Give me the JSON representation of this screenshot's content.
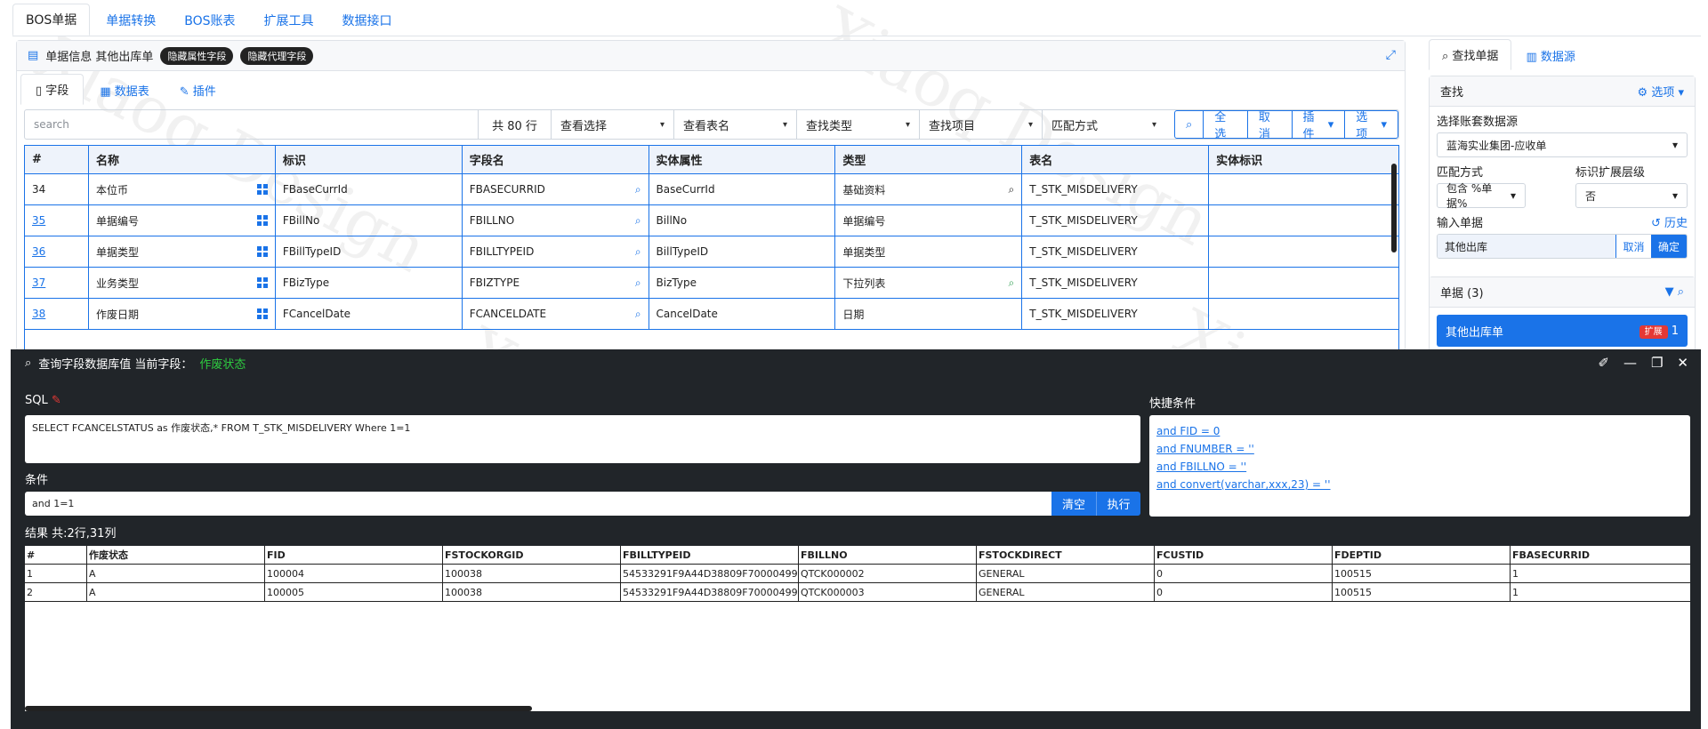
{
  "top_tabs": [
    "BOS单据",
    "单据转换",
    "BOS账表",
    "扩展工具",
    "数据接口"
  ],
  "panel": {
    "title": "单据信息 其他出库单",
    "badge1": "隐藏属性字段",
    "badge2": "隐藏代理字段",
    "subtabs": [
      "字段",
      "数据表",
      "插件"
    ]
  },
  "filter": {
    "search_placeholder": "search",
    "count": "共 80 行",
    "selects": [
      "查看选择",
      "查看表名",
      "查找类型",
      "查找项目",
      "匹配方式"
    ],
    "btn_all": "全选",
    "btn_cancel": "取消",
    "btn_plugin": "插件",
    "btn_options": "选项"
  },
  "grid": {
    "headers": [
      "#",
      "名称",
      "标识",
      "字段名",
      "实体属性",
      "类型",
      "表名",
      "实体标识"
    ],
    "rows": [
      {
        "n": "34",
        "name": "本位币",
        "key": "FBaseCurrId",
        "field": "FBASECURRID",
        "prop": "BaseCurrId",
        "type": "基础资料",
        "table": "T_STK_MISDELIVERY",
        "entity": ""
      },
      {
        "n": "35",
        "name": "单据编号",
        "key": "FBillNo",
        "field": "FBILLNO",
        "prop": "BillNo",
        "type": "单据编号",
        "table": "T_STK_MISDELIVERY",
        "entity": ""
      },
      {
        "n": "36",
        "name": "单据类型",
        "key": "FBillTypeID",
        "field": "FBILLTYPEID",
        "prop": "BillTypeID",
        "type": "单据类型",
        "table": "T_STK_MISDELIVERY",
        "entity": ""
      },
      {
        "n": "37",
        "name": "业务类型",
        "key": "FBizType",
        "field": "FBIZTYPE",
        "prop": "BizType",
        "type": "下拉列表",
        "table": "T_STK_MISDELIVERY",
        "entity": ""
      },
      {
        "n": "38",
        "name": "作废日期",
        "key": "FCancelDate",
        "field": "FCANCELDATE",
        "prop": "CancelDate",
        "type": "日期",
        "table": "T_STK_MISDELIVERY",
        "entity": ""
      }
    ]
  },
  "right": {
    "tab1": "查找单据",
    "tab2": "数据源",
    "find_title": "查找",
    "options": "选项",
    "label_source": "选择账套数据源",
    "source_value": "蓝海实业集团-应收单",
    "label_match": "匹配方式",
    "label_level": "标识扩展层级",
    "match_value": "包含 %单据%",
    "level_value": "否",
    "label_input": "输入单据",
    "history": "历史",
    "input_value": "其他出库",
    "btn_cancel": "取消",
    "btn_ok": "确定",
    "bills_title": "单据 (3)",
    "bill_active": "其他出库单",
    "bill_badge": "扩展",
    "bill_count": "1"
  },
  "modal": {
    "title": "查询字段数据库值 当前字段：",
    "current_field": "作废状态",
    "sql_label": "SQL",
    "sql": "SELECT FCANCELSTATUS as 作废状态,* FROM T_STK_MISDELIVERY Where 1=1",
    "quick_label": "快捷条件",
    "quick": [
      "and FID = 0",
      "and FNUMBER = ''",
      "and FBILLNO = ''",
      "and convert(varchar,xxx,23) = ''"
    ],
    "cond_label": "条件",
    "cond": "and 1=1",
    "btn_clear": "清空",
    "btn_exec": "执行",
    "result_label": "结果 共:2行,31列",
    "result_headers": [
      "#",
      "作废状态",
      "FID",
      "FSTOCKORGID",
      "FBILLTYPEID",
      "FBILLNO",
      "FSTOCKDIRECT",
      "FCUSTID",
      "FDEPTID",
      "FBASECURRID"
    ],
    "result_rows": [
      [
        "1",
        "A",
        "100004",
        "100038",
        "54533291F9A44D38809F70000499",
        "QTCK000002",
        "GENERAL",
        "0",
        "100515",
        "1"
      ],
      [
        "2",
        "A",
        "100005",
        "100038",
        "54533291F9A44D38809F70000499",
        "QTCK000003",
        "GENERAL",
        "0",
        "100515",
        "1"
      ]
    ]
  },
  "colors": {
    "accent": "#1a73e8",
    "dark": "#212529",
    "green": "#2ecc40",
    "red": "#e53935"
  }
}
